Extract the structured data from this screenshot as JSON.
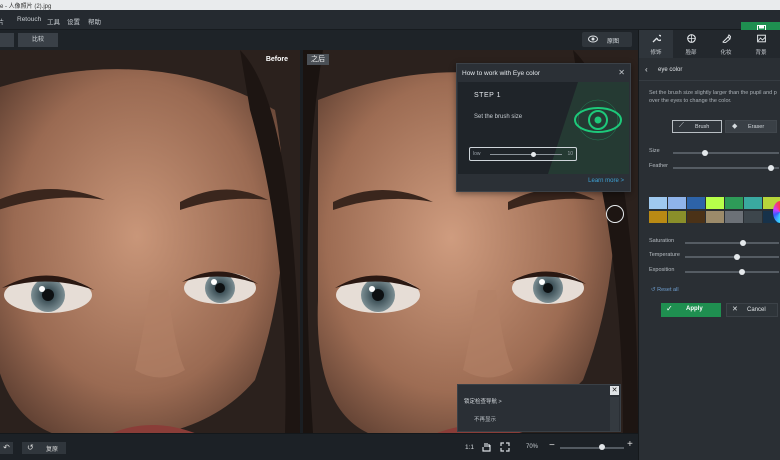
{
  "window": {
    "title": "e - 人像照片 (2).jpg"
  },
  "menu": [
    {
      "label": "图片"
    },
    {
      "label": "Retouch"
    },
    {
      "label": "工具"
    },
    {
      "label": "设置"
    },
    {
      "label": "帮助"
    }
  ],
  "toolbar": {
    "compare_label": "比较",
    "view_label": "原图"
  },
  "canvas": {
    "before_label": "Before",
    "after_label": "之后"
  },
  "hint": {
    "title": "How to work with Eye color",
    "step": "STEP 1",
    "text": "Set the brush size",
    "slider_min": "low",
    "slider_max": "10",
    "slider_fraction": 0.6,
    "learn_more": "Learn more >"
  },
  "popup": {
    "line1": "锁定检查导航 >",
    "line2": "不再显示"
  },
  "bottom": {
    "reset_label": "复原",
    "ratio": "1:1",
    "zoom": "70%",
    "zoom_fraction": 0.65
  },
  "panel": {
    "tabs": [
      {
        "label": "修饰",
        "icon": "wrench-icon"
      },
      {
        "label": "脸部",
        "icon": "face-icon"
      },
      {
        "label": "化妆",
        "icon": "makeup-icon"
      },
      {
        "label": "背景",
        "icon": "background-icon"
      }
    ],
    "section_title": "eye color",
    "description_line1": "Set the brush size slightly larger than the pupil and p",
    "description_line2": "over the eyes to change the color.",
    "brush_label": "Brush",
    "eraser_label": "Eraser",
    "sliders": [
      {
        "label": "Size",
        "fraction": 0.3
      },
      {
        "label": "Feather",
        "fraction": 0.92
      },
      {
        "label": "Saturation",
        "fraction": 0.62
      },
      {
        "label": "Temperature",
        "fraction": 0.55
      },
      {
        "label": "Exposition",
        "fraction": 0.61
      }
    ],
    "swatches": [
      "#9fc9ef",
      "#8fb4ea",
      "#2d63a8",
      "#b7ff4a",
      "#2e9b58",
      "#3aa9a0",
      "#b7d63a",
      "#b98a14",
      "#8a8f2a",
      "#4b3217",
      "#9c8b6a",
      "#6c7177",
      "#3d464c",
      "#17324a"
    ],
    "reset_all": "Reset all",
    "apply_label": "Apply",
    "cancel_label": "Cancel"
  },
  "colors": {
    "accent": "#1f8f50",
    "link": "#3ea2d6"
  }
}
